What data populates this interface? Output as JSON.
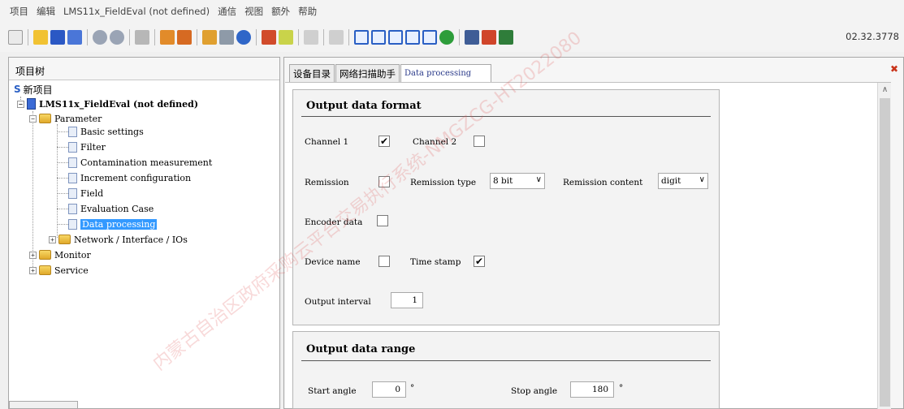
{
  "menubar": {
    "items": [
      "项目",
      "编辑",
      "LMS11x_FieldEval (not defined)",
      "通信",
      "视图",
      "额外",
      "帮助"
    ]
  },
  "toolbar": {
    "version": "02.32.3778"
  },
  "left_panel": {
    "title": "项目树",
    "tree": {
      "root": "新项目",
      "device": "LMS11x_FieldEval (not defined)",
      "parameter": "Parameter",
      "children": [
        "Basic settings",
        "Filter",
        "Contamination measurement",
        "Increment configuration",
        "Field",
        "Evaluation Case",
        "Data processing"
      ],
      "network": "Network / Interface / IOs",
      "monitor": "Monitor",
      "service": "Service"
    }
  },
  "right_panel": {
    "tabs": [
      "设备目录",
      "网络扫描助手",
      "Data processing"
    ],
    "output_format": {
      "title": "Output data format",
      "channel1_label": "Channel 1",
      "channel1_checked": "✔",
      "channel2_label": "Channel 2",
      "remission_label": "Remission",
      "remission_type_label": "Remission type",
      "remission_type_value": "8 bit",
      "remission_content_label": "Remission content",
      "remission_content_value": "digit",
      "encoder_label": "Encoder data",
      "device_name_label": "Device name",
      "time_stamp_label": "Time stamp",
      "time_stamp_checked": "✔",
      "output_interval_label": "Output interval",
      "output_interval_value": "1"
    },
    "output_range": {
      "title": "Output data range",
      "start_label": "Start angle",
      "start_value": "0",
      "stop_label": "Stop angle",
      "stop_value": "180",
      "degree": "°"
    }
  },
  "colors": {
    "selection": "#3399ff",
    "close": "#c9341a",
    "section_bg": "#f3f3f3"
  },
  "watermark": "内蒙古自治区政府采购云平台交易执行系统-NMGZCG-HT2022080"
}
